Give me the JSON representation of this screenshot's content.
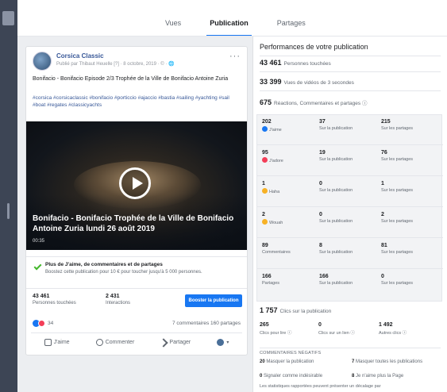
{
  "tabs": [
    "Vues",
    "Publication",
    "Partages"
  ],
  "post": {
    "page_name": "Corsica Classic",
    "meta": "Publié par Thibaut Heuelle [?] · 8 octobre, 2019 · © · 🌐",
    "more": "···",
    "text": "Bonifacio - Bonifacio Episode 2/3 Trophée de la Ville de Bonifacio Antoine Zuria",
    "tags": "#corsica #corsicaclassic #bonifacio #porticcio #ajaccio #bastia #sailing #yachting #sail #boat #regates #classicyachts",
    "video_title": "Bonifacio - Bonifacio Trophée de la Ville de Bonifacio Antoine Zuria lundi 26 août 2019",
    "video_duration": "00:35",
    "boost_title": "Plus de J'aime, de commentaires et de partages",
    "boost_sub": "Boostez cette publication pour 10 € pour toucher jusqu'à 5 000 personnes.",
    "stat1_num": "43 461",
    "stat1_label": "Personnes touchées",
    "stat2_num": "2 431",
    "stat2_label": "Interactions",
    "boost_button": "Booster la publication",
    "reaction_count": "34",
    "comments_shares": "7 commentaires 160 partages",
    "action_like": "J'aime",
    "action_comment": "Commenter",
    "action_share": "Partager"
  },
  "panel": {
    "title": "Performances de votre publication",
    "reached_num": "43 461",
    "reached_label": "Personnes touchées",
    "views_num": "33 399",
    "views_label": "Vues de vidéos de 3 secondes",
    "reactions_num": "675",
    "reactions_label": "Réactions, Commentaires et partages ⓘ",
    "grid": [
      {
        "a": "202",
        "al": "J'aime",
        "b": "37",
        "bl": "Sur la publication",
        "c": "215",
        "cl": "Sur les partages",
        "icon": "like"
      },
      {
        "a": "95",
        "al": "J'adore",
        "b": "19",
        "bl": "Sur la publication",
        "c": "76",
        "cl": "Sur les partages",
        "icon": "love"
      },
      {
        "a": "1",
        "al": "Haha",
        "b": "0",
        "bl": "Sur la publication",
        "c": "1",
        "cl": "Sur les partages",
        "icon": "haha"
      },
      {
        "a": "2",
        "al": "Wouah",
        "b": "0",
        "bl": "Sur la publication",
        "c": "2",
        "cl": "Sur les partages",
        "icon": "wow"
      },
      {
        "a": "89",
        "al": "Commentaires",
        "b": "8",
        "bl": "Sur la publication",
        "c": "81",
        "cl": "Sur les partages",
        "icon": ""
      },
      {
        "a": "166",
        "al": "Partages",
        "b": "166",
        "bl": "Sur la publication",
        "c": "0",
        "cl": "Sur les partages",
        "icon": ""
      }
    ],
    "clicks_num": "1 757",
    "clicks_label": "Clics sur la publication",
    "click_a_num": "265",
    "click_a_label": "Clics pour lire ⓘ",
    "click_b_num": "0",
    "click_b_label": "Clics sur un lien ⓘ",
    "click_c_num": "1 492",
    "click_c_label": "Autres clics ⓘ",
    "neg_title": "COMMENTAIRES NÉGATIFS",
    "neg1_num": "20",
    "neg1_label": "Masquer la publication",
    "neg2_num": "7",
    "neg2_label": "Masquer toutes les publications",
    "neg3_num": "0",
    "neg3_label": "Signaler comme indésirable",
    "neg4_num": "8",
    "neg4_label": "Je n'aime plus la Page",
    "footnote": "Les statistiques rapportées peuvent présenter un décalage par"
  },
  "colors": {
    "accent": "#1877f2",
    "like": "#1877f2",
    "love": "#f33e58",
    "haha": "#f7b125",
    "sidebar": "#3d4555"
  }
}
